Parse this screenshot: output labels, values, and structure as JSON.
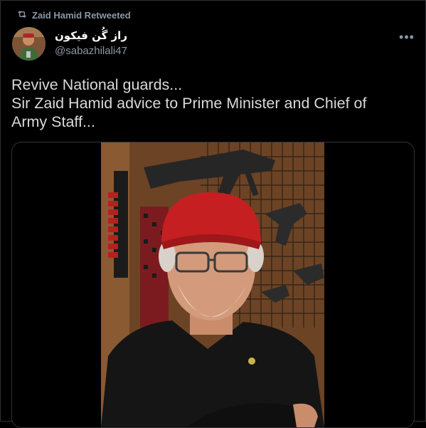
{
  "retweet": {
    "label": "Zaid Hamid Retweeted",
    "icon": "retweet-icon"
  },
  "author": {
    "display_name": "راز گُن فیکون",
    "handle": "@sabazhilali47",
    "avatar_icon": "avatar"
  },
  "more_icon": "more-icon",
  "tweet": {
    "lines": [
      "Revive National guards...",
      "Sir Zaid Hamid advice to Prime Minister and Chief of",
      "Army Staff..."
    ]
  },
  "colors": {
    "background": "#000000",
    "text": "#d9d9d9",
    "secondary": "#8b98a5",
    "border": "#2f3336"
  }
}
